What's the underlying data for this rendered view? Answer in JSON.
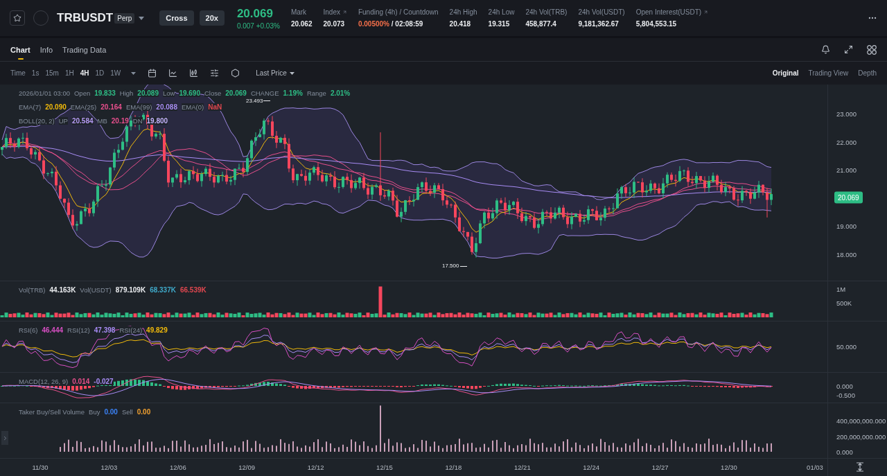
{
  "header": {
    "symbol": "TRBUSDT",
    "contract": "Perp",
    "margin_mode": "Cross",
    "leverage": "20x",
    "last_price": "20.069",
    "change": "0.007 +0.03%",
    "stats": [
      {
        "kind": "plain",
        "label": "Mark",
        "value": "20.062",
        "external": false
      },
      {
        "kind": "plain",
        "label": "Index",
        "value": "20.073",
        "external": true
      },
      {
        "kind": "funding",
        "label": "Funding (4h) / Countdown",
        "value": "0.00500%",
        "countdown": "/ 02:08:59",
        "external": false
      },
      {
        "kind": "plain",
        "label": "24h High",
        "value": "20.418",
        "external": false
      },
      {
        "kind": "plain",
        "label": "24h Low",
        "value": "19.315",
        "external": false
      },
      {
        "kind": "plain",
        "label": "24h Vol(TRB)",
        "value": "458,877.4",
        "external": false
      },
      {
        "kind": "plain",
        "label": "24h Vol(USDT)",
        "value": "9,181,362.67",
        "external": false
      },
      {
        "kind": "plain",
        "label": "Open Interest(USDT)",
        "value": "5,804,553.15",
        "external": true
      }
    ]
  },
  "tabs": [
    {
      "label": "Chart",
      "selected": true
    },
    {
      "label": "Info",
      "selected": false
    },
    {
      "label": "Trading Data",
      "selected": false
    }
  ],
  "intervals": [
    {
      "label": "Time",
      "selected": false
    },
    {
      "label": "1s",
      "selected": false
    },
    {
      "label": "15m",
      "selected": false
    },
    {
      "label": "1H",
      "selected": false
    },
    {
      "label": "4H",
      "selected": true
    },
    {
      "label": "1D",
      "selected": false
    },
    {
      "label": "1W",
      "selected": false
    }
  ],
  "price_type": "Last Price",
  "views": [
    {
      "label": "Original",
      "selected": true
    },
    {
      "label": "Trading View",
      "selected": false
    },
    {
      "label": "Depth",
      "selected": false
    }
  ],
  "main_pane": {
    "ohlc": {
      "date": "2026/01/01 03:00",
      "items": [
        {
          "label": "Open",
          "value": "19.833"
        },
        {
          "label": "High",
          "value": "20.089"
        },
        {
          "label": "Low",
          "value": "19.690"
        },
        {
          "label": "Close",
          "value": "20.069"
        },
        {
          "label": "CHANGE",
          "value": "1.19%"
        },
        {
          "label": "Range",
          "value": "2.01%"
        }
      ]
    },
    "ema": [
      {
        "label": "EMA(7)",
        "value": "20.090",
        "color": "#f0b90b"
      },
      {
        "label": "EMA(25)",
        "value": "20.164",
        "color": "#e84f8c"
      },
      {
        "label": "EMA(99)",
        "value": "20.088",
        "color": "#a88cf5"
      },
      {
        "label": "EMA(0)",
        "value": "NaN",
        "color": "#e0474f"
      }
    ],
    "boll": {
      "label": "BOLL(20, 2)",
      "items": [
        {
          "label": "UP",
          "value": "20.584",
          "color": "#b79bf7"
        },
        {
          "label": "MB",
          "value": "20.19",
          "color": "#e84f8c"
        },
        {
          "label": "DN",
          "value": "19.800",
          "color": "#c5b3ff"
        }
      ]
    },
    "high_marker": "23.493",
    "low_marker": "17.500",
    "axis": [
      "23.000",
      "22.000",
      "21.000",
      "19.000",
      "18.000"
    ],
    "current_price": "20.069"
  },
  "volume_pane": {
    "items": [
      {
        "label": "Vol(TRB)",
        "value": "44.163K",
        "color": "#eaecef"
      },
      {
        "label": "Vol(USDT)",
        "value": "879.109K",
        "color": "#eaecef"
      },
      {
        "value": "68.337K",
        "color": "#3fa9c9"
      },
      {
        "value": "66.539K",
        "color": "#e0474f"
      }
    ],
    "axis": [
      "1M",
      "500K"
    ]
  },
  "rsi_pane": {
    "items": [
      {
        "label": "RSI(6)",
        "value": "46.444",
        "color": "#d84fc4"
      },
      {
        "label": "RSI(12)",
        "value": "47.398",
        "color": "#a88cf5"
      },
      {
        "label": "RSI(24)",
        "value": "49.829",
        "color": "#f0b90b"
      }
    ],
    "axis": [
      "50.000"
    ]
  },
  "macd_pane": {
    "label": "MACD(12, 26, 9)",
    "items": [
      {
        "value": "0.014",
        "color": "#e84f8c"
      },
      {
        "value": "-0.027",
        "color": "#a88cf5"
      }
    ],
    "axis": [
      "0.000",
      "-0.500"
    ]
  },
  "taker_pane": {
    "label": "Taker Buy/Sell Volume",
    "items": [
      {
        "label": "Buy",
        "value": "0.00",
        "color": "#3b82f6"
      },
      {
        "label": "Sell",
        "value": "0.00",
        "color": "#f0a030"
      }
    ],
    "axis": [
      "400,000,000.000",
      "200,000,000.000",
      "0.000"
    ]
  },
  "time_axis": [
    "11/30",
    "12/03",
    "12/06",
    "12/09",
    "12/12",
    "12/15",
    "12/18",
    "12/21",
    "12/24",
    "12/27",
    "12/30",
    "01/03"
  ]
}
